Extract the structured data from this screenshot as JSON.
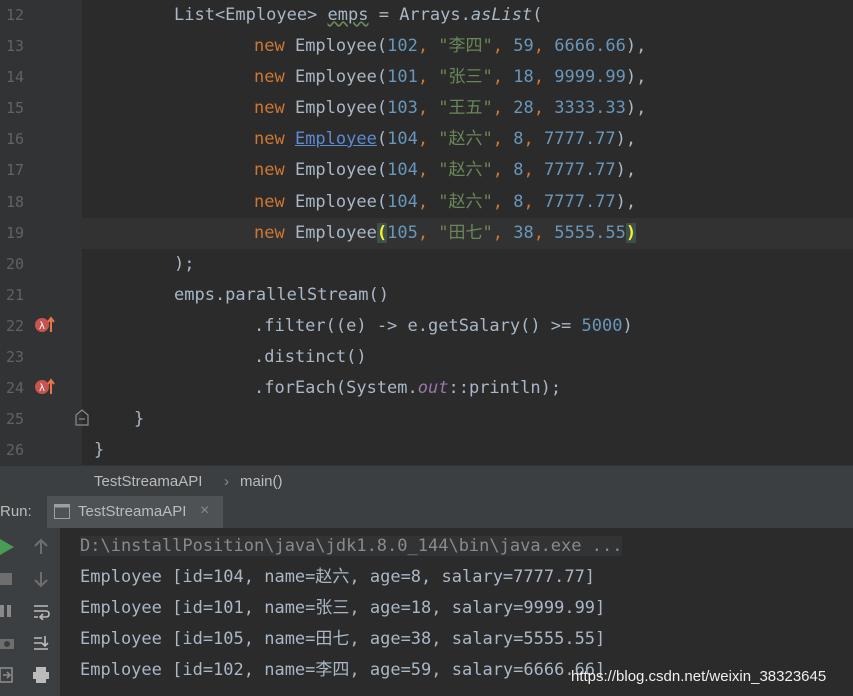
{
  "editor": {
    "line_numbers": [
      "12",
      "13",
      "14",
      "15",
      "16",
      "17",
      "18",
      "19",
      "20",
      "21",
      "22",
      "23",
      "24",
      "25",
      "26"
    ],
    "lines": {
      "l12": {
        "a": "List<Employee> ",
        "b": "emps",
        "c": " = Arrays.",
        "d": "asList",
        "e": "("
      },
      "l13": {
        "kw": "new ",
        "cls": "Employee",
        "p1": "(",
        "n1": "102",
        "s": ", ",
        "str": "\"李四\"",
        "s2": ", ",
        "n2": "59",
        "s3": ", ",
        "n3": "6666.66",
        "end": "),"
      },
      "l14": {
        "kw": "new ",
        "cls": "Employee",
        "p1": "(",
        "n1": "101",
        "s": ", ",
        "str": "\"张三\"",
        "s2": ", ",
        "n2": "18",
        "s3": ", ",
        "n3": "9999.99",
        "end": "),"
      },
      "l15": {
        "kw": "new ",
        "cls": "Employee",
        "p1": "(",
        "n1": "103",
        "s": ", ",
        "str": "\"王五\"",
        "s2": ", ",
        "n2": "28",
        "s3": ", ",
        "n3": "3333.33",
        "end": "),"
      },
      "l16": {
        "kw": "new ",
        "cls": "Employee",
        "p1": "(",
        "n1": "104",
        "s": ", ",
        "str": "\"赵六\"",
        "s2": ", ",
        "n2": "8",
        "s3": ", ",
        "n3": "7777.77",
        "end": "),"
      },
      "l17": {
        "kw": "new ",
        "cls": "Employee",
        "p1": "(",
        "n1": "104",
        "s": ", ",
        "str": "\"赵六\"",
        "s2": ", ",
        "n2": "8",
        "s3": ", ",
        "n3": "7777.77",
        "end": "),"
      },
      "l18": {
        "kw": "new ",
        "cls": "Employee",
        "p1": "(",
        "n1": "104",
        "s": ", ",
        "str": "\"赵六\"",
        "s2": ", ",
        "n2": "8",
        "s3": ", ",
        "n3": "7777.77",
        "end": "),"
      },
      "l19": {
        "kw": "new ",
        "cls": "Employee",
        "p1": "(",
        "n1": "105",
        "s": ", ",
        "str": "\"田七\"",
        "s2": ", ",
        "n2": "38",
        "s3": ", ",
        "n3": "5555.55",
        "end": ")"
      },
      "l20": {
        "a": ");"
      },
      "l21": {
        "a": "emps.parallelStream()"
      },
      "l22": {
        "a": ".filter((e) -> e.getSalary() >= ",
        "n": "5000",
        "b": ")"
      },
      "l23": {
        "a": ".distinct()"
      },
      "l24": {
        "a": ".forEach(System.",
        "b": "out",
        "c": "::println);"
      },
      "l25": {
        "a": "}"
      },
      "l26": {
        "a": "}"
      }
    }
  },
  "breadcrumb": {
    "class_name": "TestStreamaAPI",
    "separator": "›",
    "method": "main()"
  },
  "run": {
    "label": "Run:",
    "tab_label": "TestStreamaAPI",
    "close": "×"
  },
  "console": {
    "command": "D:\\installPosition\\java\\jdk1.8.0_144\\bin\\java.exe ...",
    "output": [
      "Employee [id=104, name=赵六, age=8, salary=7777.77]",
      "Employee [id=101, name=张三, age=18, salary=9999.99]",
      "Employee [id=105, name=田七, age=38, salary=5555.55]",
      "Employee [id=102, name=李四, age=59, salary=6666.66]"
    ]
  },
  "watermark": "https://blog.csdn.net/weixin_38323645",
  "icons": [
    "lambda-icon",
    "fold-icon",
    "run-icon",
    "up-icon",
    "down-icon",
    "stop-icon",
    "wrap-icon",
    "pause-icon",
    "scroll-end-icon",
    "camera-icon",
    "print-icon",
    "login-icon",
    "console-icon",
    "close-icon"
  ]
}
